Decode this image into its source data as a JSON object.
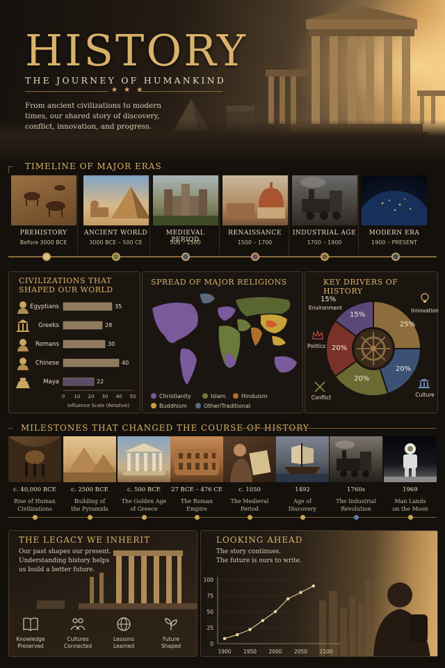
{
  "hero": {
    "title": "HISTORY",
    "subtitle": "THE JOURNEY OF HUMANKIND",
    "stars": "★ ★ ★",
    "description": "From ancient civilizations to modern times, our shared story of discovery, conflict, innovation, and progress."
  },
  "timeline": {
    "heading": "TIMELINE OF MAJOR ERAS",
    "eras": [
      {
        "name": "PREHISTORY",
        "date": "Before 3000 BCE",
        "dot_color": "#e0c08a"
      },
      {
        "name": "ANCIENT WORLD",
        "date": "3000 BCE – 500 CE",
        "dot_color": "#6d7a3a"
      },
      {
        "name": "MEDIEVAL PERIOD",
        "date": "500 – 1500",
        "dot_color": "#3f5a7a"
      },
      {
        "name": "RENAISSANCE",
        "date": "1500 – 1700",
        "dot_color": "#6a4a6e"
      },
      {
        "name": "INDUSTRIAL AGE",
        "date": "1700 – 1900",
        "dot_color": "#7a5a36"
      },
      {
        "name": "MODERN ERA",
        "date": "1900 – PRESENT",
        "dot_color": "#3d4f70"
      }
    ]
  },
  "civilizations": {
    "title": "CIVILIZATIONS THAT\nSHAPED OUR WORLD",
    "title_line1": "CIVILIZATIONS THAT",
    "title_line2": "SHAPED OUR WORLD",
    "xlabel": "Influence Scale (Relative)",
    "ticks": [
      "0",
      "10",
      "20",
      "30",
      "40",
      "50"
    ]
  },
  "chart_data": [
    {
      "type": "bar",
      "title": "CIVILIZATIONS THAT SHAPED OUR WORLD",
      "categories": [
        "Egyptians",
        "Greeks",
        "Romans",
        "Chinese",
        "Maya"
      ],
      "values": [
        35,
        28,
        30,
        40,
        22
      ],
      "colors": [
        "#8f7a5e",
        "#8f7a5e",
        "#8f7a5e",
        "#8f7a5e",
        "#5c4a66"
      ],
      "xlabel": "Influence Scale (Relative)",
      "xlim": [
        0,
        50
      ]
    },
    {
      "type": "pie",
      "title": "KEY DRIVERS OF HISTORY",
      "categories": [
        "Environment",
        "Innovation",
        "Culture",
        "Conflict",
        "Politics"
      ],
      "values": [
        15,
        25,
        20,
        20,
        20
      ],
      "colors": [
        "#5c4878",
        "#8e6d3d",
        "#3c5275",
        "#6b6a33",
        "#7a3228"
      ]
    }
  ],
  "religions": {
    "title": "SPREAD OF MAJOR RELIGIONS",
    "legend": [
      {
        "label": "Christianity",
        "color": "#7a5a9a"
      },
      {
        "label": "Islam",
        "color": "#6a7a3a"
      },
      {
        "label": "Hinduism",
        "color": "#b0702a"
      },
      {
        "label": "Buddhism",
        "color": "#c8a23a"
      },
      {
        "label": "Other/Traditional",
        "color": "#5a6a7a"
      }
    ]
  },
  "drivers": {
    "title": "KEY DRIVERS OF HISTORY",
    "labels": {
      "environment": "Environment",
      "innovation": "Innovation",
      "politics": "Politics",
      "conflict": "Conflict",
      "culture": "Culture"
    },
    "pct": {
      "environment_top": "15%",
      "environment": "15%",
      "innovation": "25%",
      "politics": "20%",
      "conflict": "20%",
      "culture": "20%"
    }
  },
  "milestones": {
    "heading": "MILESTONES THAT CHANGED THE COURSE OF HISTORY",
    "items": [
      {
        "date": "c. 40,000 BCE",
        "line1": "Rise of Human",
        "line2": "Civilizations",
        "dot_color": "#c9a560"
      },
      {
        "date": "c. 2500 BCE",
        "line1": "Building of",
        "line2": "the Pyramids",
        "dot_color": "#c9a560"
      },
      {
        "date": "c. 500 BCE",
        "line1": "The Golden Age",
        "line2": "of Greece",
        "dot_color": "#c9a560"
      },
      {
        "date": "27 BCE – 476 CE",
        "line1": "The Roman",
        "line2": "Empire",
        "dot_color": "#c9a560"
      },
      {
        "date": "c. 1050",
        "line1": "The Medieval",
        "line2": "Period",
        "dot_color": "#c9a560"
      },
      {
        "date": "1492",
        "line1": "Age of",
        "line2": "Discovery",
        "dot_color": "#c9a560"
      },
      {
        "date": "1760s",
        "line1": "The Industrial",
        "line2": "Revolution",
        "dot_color": "#5b7ea8"
      },
      {
        "date": "1969",
        "line1": "Man Lands",
        "line2": "on the Moon",
        "dot_color": "#c9a560"
      }
    ]
  },
  "legacy": {
    "heading": "THE LEGACY WE INHERIT",
    "line1": "Our past shapes our present.",
    "line2": "Understanding history helps",
    "line3": "us build a better future.",
    "items": [
      {
        "line1": "Knowledge",
        "line2": "Preserved"
      },
      {
        "line1": "Cultures",
        "line2": "Connected"
      },
      {
        "line1": "Lessons",
        "line2": "Learned"
      },
      {
        "line1": "Future",
        "line2": "Shaped"
      }
    ]
  },
  "ahead": {
    "heading": "LOOKING AHEAD",
    "line1": "The story continues.",
    "line2": "The future is ours to write.",
    "y_ticks": [
      "0",
      "25",
      "50",
      "75",
      "100"
    ],
    "x_ticks": [
      "1900",
      "1950",
      "2000",
      "2050",
      "2100"
    ],
    "series": [
      {
        "x": 1900,
        "y": 8
      },
      {
        "x": 1925,
        "y": 14
      },
      {
        "x": 1950,
        "y": 22
      },
      {
        "x": 1975,
        "y": 36
      },
      {
        "x": 2000,
        "y": 50
      },
      {
        "x": 2025,
        "y": 70
      },
      {
        "x": 2050,
        "y": 80
      },
      {
        "x": 2075,
        "y": 90
      }
    ]
  }
}
